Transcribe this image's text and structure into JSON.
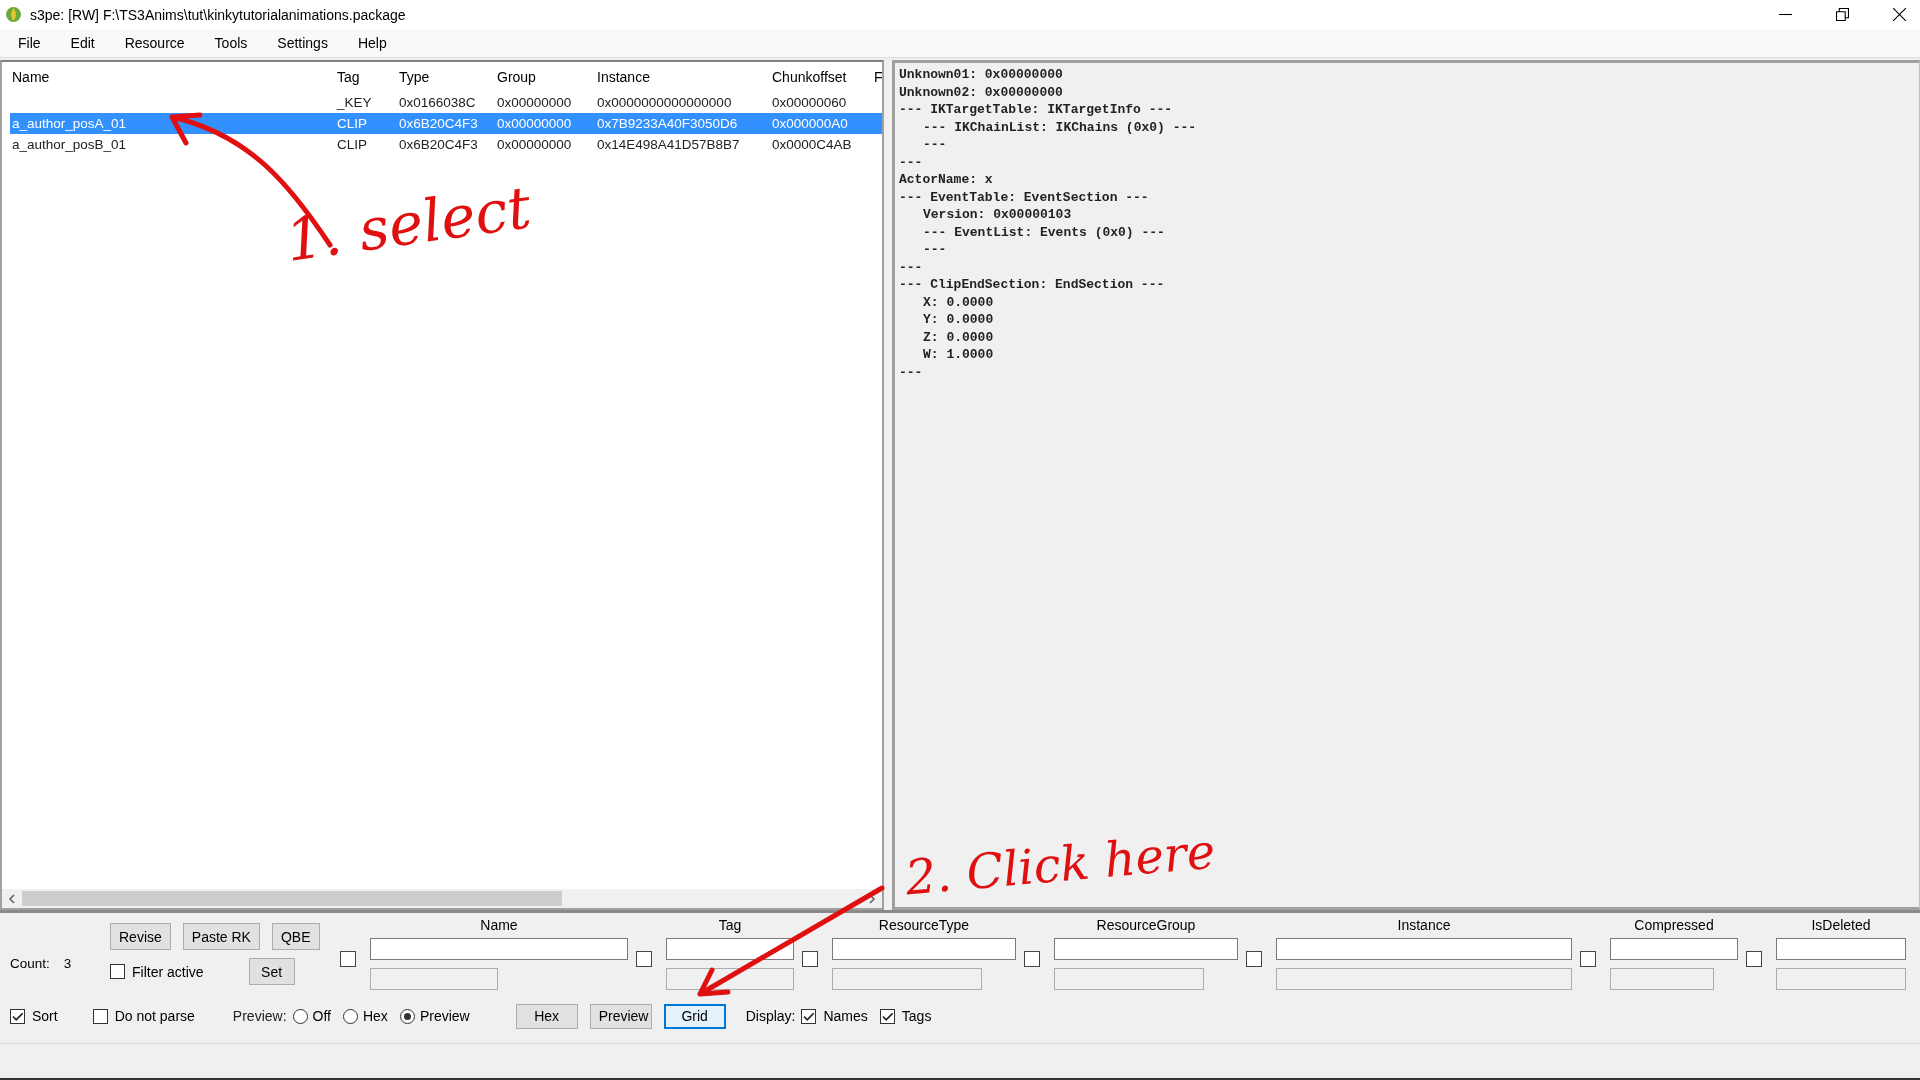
{
  "window": {
    "title": "s3pe: [RW] F:\\TS3Anims\\tut\\kinkytutorialanimations.package"
  },
  "menu": [
    "File",
    "Edit",
    "Resource",
    "Tools",
    "Settings",
    "Help"
  ],
  "resource_list": {
    "columns": [
      "Name",
      "Tag",
      "Type",
      "Group",
      "Instance",
      "Chunkoffset",
      "F"
    ],
    "rows": [
      {
        "tag": "_KEY",
        "type": "0x0166038C",
        "group": "0x00000000",
        "instance": "0x0000000000000000",
        "chunkoffset": "0x00000060",
        "selected": false
      },
      {
        "name": "a_author_posA_01",
        "tag": "CLIP",
        "type": "0x6B20C4F3",
        "group": "0x00000000",
        "instance": "0x7B9233A40F3050D6",
        "chunkoffset": "0x000000A0",
        "selected": true
      },
      {
        "name": "a_author_posB_01",
        "tag": "CLIP",
        "type": "0x6B20C4F3",
        "group": "0x00000000",
        "instance": "0x14E498A41D57B8B7",
        "chunkoffset": "0x0000C4AB",
        "selected": false
      }
    ]
  },
  "preview_lines": [
    {
      "text": "Unknown01: 0x00000000",
      "kind": "plain"
    },
    {
      "text": "Unknown02: 0x00000000",
      "kind": "plain"
    },
    {
      "text": "--- IKTargetTable: IKTargetInfo ---",
      "kind": "plain"
    },
    {
      "text": "--- IKChainList: IKChains (0x0) ---",
      "kind": "indented"
    },
    {
      "text": "---",
      "kind": "indented"
    },
    {
      "text": "---",
      "kind": "plain"
    },
    {
      "text": "ActorName: x",
      "kind": "plain"
    },
    {
      "text": "--- EventTable: EventSection ---",
      "kind": "plain"
    },
    {
      "text": "Version: 0x00000103",
      "kind": "indented"
    },
    {
      "text": "--- EventList: Events (0x0) ---",
      "kind": "indented"
    },
    {
      "text": "---",
      "kind": "indented"
    },
    {
      "text": "---",
      "kind": "plain"
    },
    {
      "text": "--- ClipEndSection: EndSection ---",
      "kind": "plain"
    },
    {
      "text": "X: 0.0000",
      "kind": "indented"
    },
    {
      "text": "Y: 0.0000",
      "kind": "indented"
    },
    {
      "text": "Z: 0.0000",
      "kind": "indented"
    },
    {
      "text": "W: 1.0000",
      "kind": "indented"
    },
    {
      "text": "---",
      "kind": "plain"
    }
  ],
  "filter": {
    "count_label": "Count:",
    "count": "3",
    "buttons": [
      "Revise",
      "Paste RK",
      "QBE"
    ],
    "filter_active": {
      "label": "Filter active",
      "checked": false
    },
    "set_button": "Set",
    "fields": [
      {
        "label": "Name",
        "checked": false
      },
      {
        "label": "Tag",
        "checked": false
      },
      {
        "label": "ResourceType",
        "checked": false
      },
      {
        "label": "ResourceGroup",
        "checked": false
      },
      {
        "label": "Instance",
        "checked": false
      },
      {
        "label": "Compressed",
        "checked": false
      },
      {
        "label": "IsDeleted",
        "checked": false
      }
    ]
  },
  "options": {
    "sort": {
      "label": "Sort",
      "checked": true
    },
    "do_not_parse": {
      "label": "Do not parse",
      "checked": false
    },
    "preview_label": "Preview:",
    "preview_modes": [
      {
        "label": "Off",
        "selected": false
      },
      {
        "label": "Hex",
        "selected": false
      },
      {
        "label": "Preview",
        "selected": true
      }
    ],
    "view_buttons": [
      {
        "label": "Hex",
        "focused": false
      },
      {
        "label": "Preview",
        "focused": false
      },
      {
        "label": "Grid",
        "focused": true
      }
    ],
    "display_label": "Display:",
    "display": [
      {
        "label": "Names",
        "checked": true
      },
      {
        "label": "Tags",
        "checked": true
      }
    ]
  },
  "annotations": [
    {
      "text": "1. select"
    },
    {
      "text": "2. Click here"
    }
  ]
}
